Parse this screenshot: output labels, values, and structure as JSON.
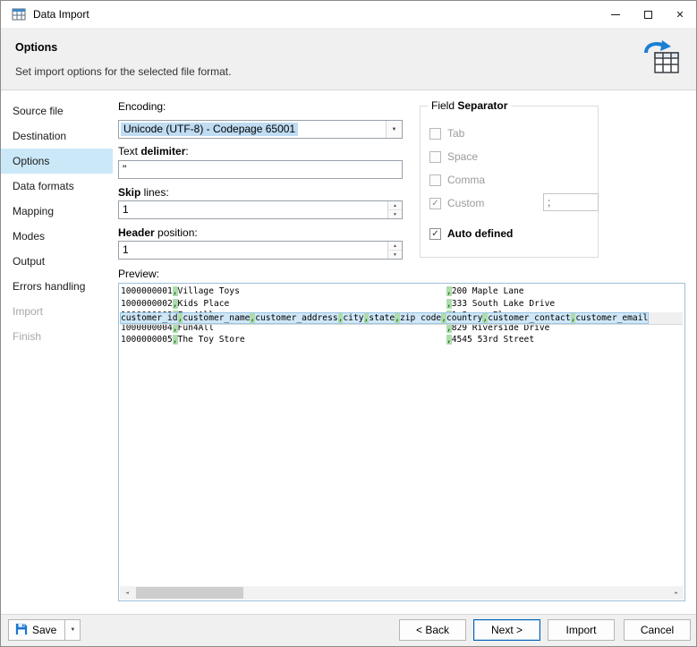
{
  "window": {
    "title": "Data Import"
  },
  "icons": {
    "close": "✕",
    "combo_arrow": "▼",
    "spin_up": "▲",
    "spin_down": "▼",
    "check": "✓",
    "scroll_left": "◄",
    "scroll_right": "►",
    "save_dropdown": "▼"
  },
  "header": {
    "title": "Options",
    "subtitle": "Set import options for the selected file format."
  },
  "sidebar": {
    "items": [
      {
        "label": "Source file",
        "state": "normal"
      },
      {
        "label": "Destination",
        "state": "normal"
      },
      {
        "label": "Options",
        "state": "selected"
      },
      {
        "label": "Data formats",
        "state": "normal"
      },
      {
        "label": "Mapping",
        "state": "normal"
      },
      {
        "label": "Modes",
        "state": "normal"
      },
      {
        "label": "Output",
        "state": "normal"
      },
      {
        "label": "Errors handling",
        "state": "normal"
      },
      {
        "label": "Import",
        "state": "disabled"
      },
      {
        "label": "Finish",
        "state": "disabled"
      }
    ]
  },
  "form": {
    "encoding_label": {
      "pre": "Encoding:",
      "bold": "",
      "post": ""
    },
    "encoding_value": "Unicode (UTF-8) - Codepage 65001",
    "delimiter_label": {
      "pre": "Text ",
      "bold": "delimiter",
      "post": ":"
    },
    "delimiter_value": "\"",
    "skip_label": {
      "pre": "",
      "bold": "Skip",
      "post": " lines:"
    },
    "skip_value": "1",
    "header_label": {
      "pre": "",
      "bold": "Header",
      "post": " position:"
    },
    "header_value": "1"
  },
  "field_separator": {
    "legend": {
      "pre": "Field ",
      "bold": "Separator",
      "post": ""
    },
    "options": [
      {
        "label": "Tab",
        "checked": false,
        "enabled": false
      },
      {
        "label": "Space",
        "checked": false,
        "enabled": false
      },
      {
        "label": "Comma",
        "checked": false,
        "enabled": false
      },
      {
        "label": "Custom",
        "checked": true,
        "enabled": false,
        "input_value": ";"
      },
      {
        "label": "Auto defined",
        "checked": true,
        "enabled": true,
        "bold": true
      }
    ]
  },
  "preview": {
    "label": "Preview:",
    "header_line": "customer_id,customer_name,customer_address,city,state,zip code,country,customer_contact,customer_email",
    "lines": [
      {
        "left": "1000000001,Village Toys",
        "pad": 40,
        "right": ",200 Maple Lane"
      },
      {
        "left": "1000000002,Kids Place",
        "pad": 42,
        "right": ",333 South Lake Drive"
      },
      {
        "left": "1000000003,Fun4All",
        "pad": 45,
        "right": ",1 Sunny Place"
      },
      {
        "left": "1000000004,Fun4All",
        "pad": 45,
        "right": ",829 Riverside Drive"
      },
      {
        "left": "1000000005,The Toy Store",
        "pad": 39,
        "right": ",4545 53rd Street"
      }
    ]
  },
  "footer": {
    "save": "Save",
    "back": "< Back",
    "next": "Next >",
    "import": "Import",
    "cancel": "Cancel"
  }
}
